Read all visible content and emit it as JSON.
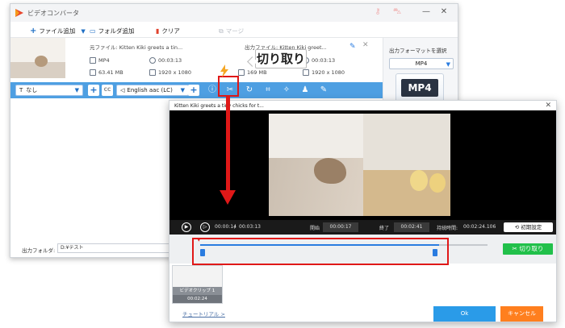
{
  "app": {
    "title": "ビデオコンバータ",
    "window_controls": {
      "minimize": "—",
      "close": "✕"
    }
  },
  "toolbar": {
    "add_file": "ファイル追加",
    "add_folder": "フォルダ追加",
    "clear": "クリア",
    "merge": "マージ"
  },
  "source": {
    "filename": "元ファイル: Kitten Kiki greets a tin...",
    "format": "MP4",
    "duration": "00:03:13",
    "size": "63.41 MB",
    "resolution": "1920 x 1080"
  },
  "output": {
    "filename": "出力ファイル: Kitten Kiki greet...",
    "duration": "00:03:13",
    "size": "169 MB",
    "resolution": "1920 x 1080"
  },
  "format_panel": {
    "title": "出力フォーマットを選択",
    "selected": "MP4",
    "icon_label": "MP4"
  },
  "edit_bar": {
    "subtitle": "なし",
    "audio": "English aac (LC)"
  },
  "output_folder": {
    "label": "出力フォルダ:",
    "path": "D:¥テスト"
  },
  "annotation": {
    "label": "切り取り"
  },
  "dialog": {
    "title": "Kitten Kiki greets a tiny chicks for t...",
    "close": "✕",
    "controls": {
      "current_time": "00:00:14",
      "total_time": "00:03:13",
      "start_label": "開始",
      "start_value": "00:00:17",
      "end_label": "終了",
      "end_value": "00:02:41",
      "duration_label": "持続時間:",
      "duration_value": "00:02:24.106",
      "reset": "初期設定"
    },
    "cut_button": "切り取り",
    "clip": {
      "name": "ビデオクリップ 1",
      "duration": "00:02:24"
    },
    "tutorial": "チュートリアル >",
    "ok": "Ok",
    "cancel": "キャンセル"
  },
  "colors": {
    "accent_blue": "#2a7ce0",
    "edit_bar": "#4e9fe2",
    "cut_green": "#21c04a",
    "cancel_orange": "#ff7f1e",
    "annotation_red": "#e01818"
  }
}
